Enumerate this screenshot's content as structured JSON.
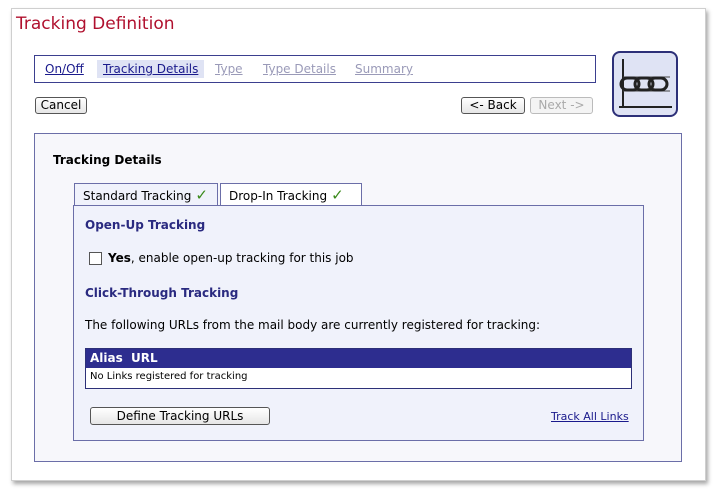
{
  "page": {
    "title": "Tracking Definition"
  },
  "wizard": {
    "steps": [
      {
        "label": "On/Off",
        "state": "link"
      },
      {
        "label": "Tracking Details",
        "state": "current"
      },
      {
        "label": "Type",
        "state": "disabled"
      },
      {
        "label": "Type Details",
        "state": "disabled"
      },
      {
        "label": "Summary",
        "state": "disabled"
      }
    ],
    "logo_icon": "chain-link-icon"
  },
  "toolbar": {
    "cancel_label": "Cancel",
    "back_label": "<- Back",
    "next_label": "Next ->"
  },
  "section": {
    "title": "Tracking Details"
  },
  "tabs": [
    {
      "label": "Standard Tracking",
      "check": "✓",
      "active": true
    },
    {
      "label": "Drop-In Tracking",
      "check": "✓",
      "active": false
    }
  ],
  "openup": {
    "heading": "Open-Up Tracking",
    "checkbox_bold": "Yes",
    "checkbox_rest": ", enable open-up tracking for this job",
    "checked": false
  },
  "clickthrough": {
    "heading": "Click-Through Tracking",
    "description": "The following URLs from the mail body are currently registered for tracking:",
    "table_headers": [
      "Alias",
      "URL"
    ],
    "empty_message": "No Links registered for tracking",
    "define_button": "Define Tracking URLs",
    "track_all_link": "Track All Links"
  },
  "colors": {
    "title": "#b0102e",
    "accent": "#2d2d8f",
    "panel": "#f0f2fb",
    "check": "#3a8a1a"
  }
}
